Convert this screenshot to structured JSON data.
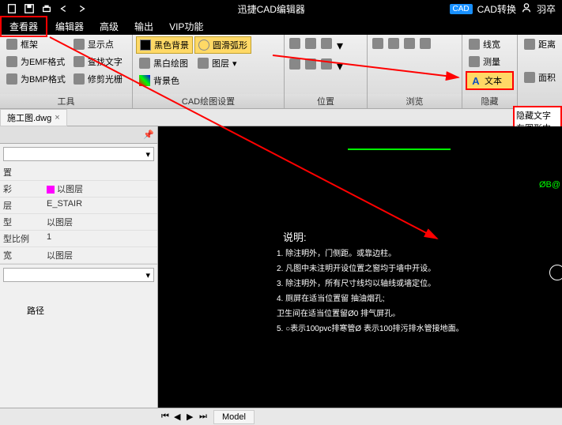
{
  "titlebar": {
    "app_title": "迅捷CAD编辑器",
    "cad_badge": "CAD",
    "convert_label": "CAD转换",
    "user_name": "羽卒"
  },
  "menu": {
    "viewer": "查看器",
    "editor": "编辑器",
    "advanced": "高级",
    "output": "输出",
    "vip": "VIP功能"
  },
  "ribbon": {
    "group1": {
      "btn_frame": "框架",
      "btn_emf": "为EMF格式",
      "btn_bmp": "为BMP格式",
      "label": "工具"
    },
    "group2": {
      "btn_showpoint": "显示点",
      "btn_findtext": "查找文字",
      "btn_trimcursor": "修剪光栅"
    },
    "group3": {
      "btn_blackbg": "黑色背景",
      "btn_bwdraw": "黑白绘图",
      "btn_bgcolor": "背景色",
      "label": "CAD绘图设置"
    },
    "group4": {
      "btn_smootharc": "圆滑弧形",
      "btn_layer": "图层"
    },
    "group5": {
      "label": "位置"
    },
    "group6": {
      "label": "浏览"
    },
    "group7": {
      "btn_linewidth": "线宽",
      "btn_measure": "测量",
      "btn_text": "文本",
      "label": "隐藏"
    },
    "group8": {
      "btn_distance": "距离",
      "btn_area": "面积"
    }
  },
  "hidden_tooltip": {
    "line1": "隐藏文字",
    "line2": "在图形中显"
  },
  "doc_tab": {
    "filename": "施工图.dwg"
  },
  "panel": {
    "prop_position": "置",
    "prop_color": "彩",
    "color_value": "以图层",
    "prop_layer": "层",
    "layer_value": "E_STAIR",
    "prop_linetype": "型",
    "linetype_value": "以图层",
    "prop_scale": "型比例",
    "scale_value": "1",
    "prop_lineweight": "宽",
    "lineweight_value": "以图层",
    "path_label": "路径"
  },
  "canvas": {
    "green_text": "ØB@",
    "explain_title": "说明:",
    "item1": "1. 除注明外，门侧距。或靠边柱。",
    "item2": "2. 凡图中未注明开设位置之窗均于墙中开设。",
    "item3": "3. 除注明外，所有尺寸线均以轴线或墙定位。",
    "item4a": "4. 厕屏在适当位置留   抽油烟孔;",
    "item4b": "   卫生间在适当位置留Ø0  排气屏孔。",
    "item5": "5. ○表示100pvc排寒管Ø  表示100排污排水管接地面。"
  },
  "bottom": {
    "model": "Model"
  }
}
